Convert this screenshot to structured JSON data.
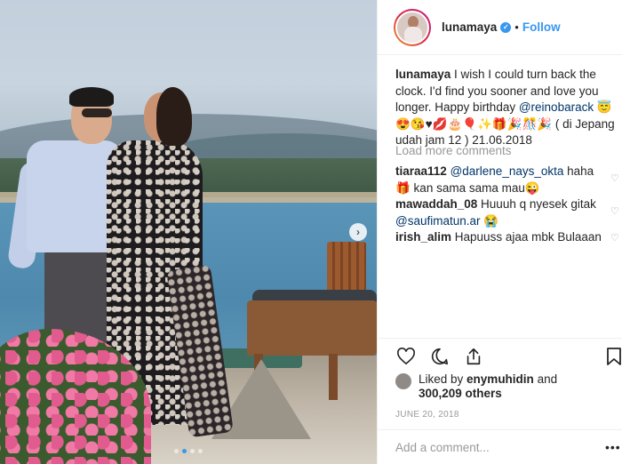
{
  "post": {
    "carousel": {
      "slide_count": 4,
      "active_index": 1
    }
  },
  "header": {
    "username": "lunamaya",
    "separator": "•",
    "follow_label": "Follow"
  },
  "caption": {
    "username": "lunamaya",
    "text_start": "I wish I could turn back the clock. I'd find you sooner and love you longer. Happy birthday ",
    "mention": "@reinobarack",
    "text_end": " 😇😍😘♥💋🎂🎈✨🎁🎉🎊🎉 ( di Jepang udah jam 12 ) 21.06.2018"
  },
  "load_more_label": "Load more comments",
  "comments": [
    {
      "user": "tiaraa112",
      "mention": "@darlene_nays_okta",
      "text": " haha 🎁 kan sama sama mau😜"
    },
    {
      "user": "mawaddah_08",
      "text": " Huuuh q nyesek gitak ",
      "mention": "@saufimatun.ar",
      "text_after": " 😭"
    },
    {
      "user": "irish_alim",
      "text": " Hapuuss ajaa mbk Bulaaan"
    }
  ],
  "likes": {
    "prefix": "Liked by ",
    "liker": "enymuhidin",
    "middle": " and",
    "count": "300,209 others"
  },
  "date": "JUNE 20, 2018",
  "comment_placeholder": "Add a comment...",
  "more_label": "•••",
  "icons": {
    "heart": "heart-icon",
    "comment": "comment-icon",
    "share": "share-icon",
    "bookmark": "bookmark-icon",
    "next": "chevron-right-icon"
  },
  "colors": {
    "accent": "#3897f0",
    "link": "#003569",
    "muted": "#999999"
  }
}
